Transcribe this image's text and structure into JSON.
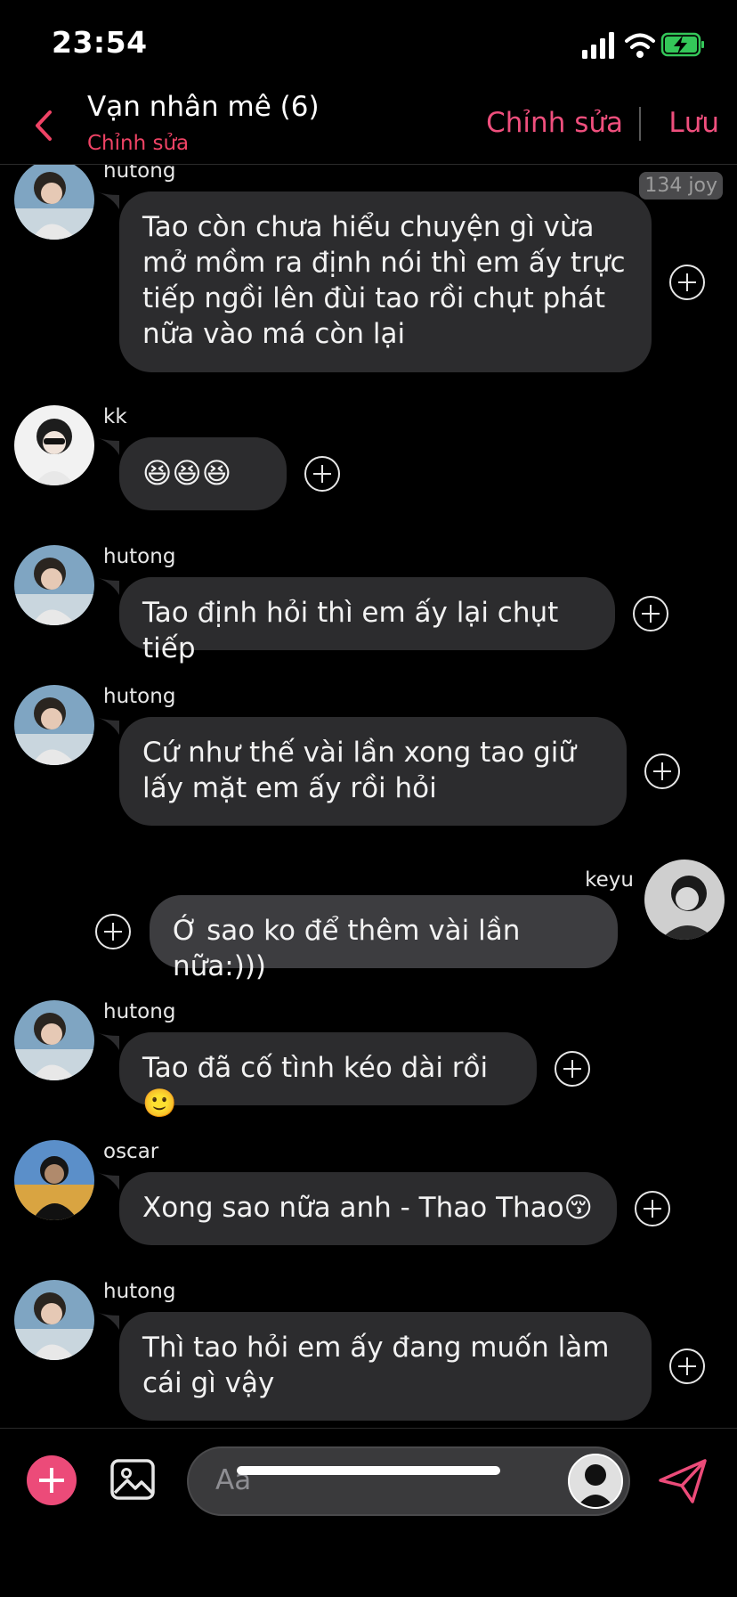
{
  "status_bar": {
    "time": "23:54"
  },
  "header": {
    "title": "Vạn nhân mê (6)",
    "subtitle": "Chỉnh sửa",
    "edit_label": "Chỉnh sửa",
    "save_label": "Lưu"
  },
  "messages": [
    {
      "sender": "hutong",
      "text": "Tao còn chưa hiểu chuyện gì vừa mở mồm ra định nói thì em ấy trực tiếp ngồi lên đùi tao rồi chụt phát nữa vào má còn lại",
      "badge": "134 joy"
    },
    {
      "sender": "kk",
      "text": "😆😆😆"
    },
    {
      "sender": "hutong",
      "text": "Tao định hỏi thì em ấy lại chụt tiếp"
    },
    {
      "sender": "hutong",
      "text": "Cứ như thế vài lần xong tao giữ lấy mặt em ấy rồi hỏi"
    },
    {
      "sender": "keyu",
      "text": "Ớ sao ko để thêm vài lần nữa:)))"
    },
    {
      "sender": "hutong",
      "text": "Tao đã cố tình kéo dài rồi🙂"
    },
    {
      "sender": "oscar",
      "text": "Xong sao nữa anh - Thao Thao😚"
    },
    {
      "sender": "hutong",
      "text": "Thì tao hỏi em ấy đang muốn làm cái gì vậy"
    }
  ],
  "composer": {
    "placeholder": "Aa"
  },
  "colors": {
    "accent": "#ef4f7d",
    "bubble": "#2c2c2e",
    "background": "#000000"
  },
  "icons": [
    "back-chevron-icon",
    "signal-icon",
    "wifi-icon",
    "battery-charging-icon",
    "plus-circle-icon",
    "gallery-icon",
    "send-icon"
  ]
}
